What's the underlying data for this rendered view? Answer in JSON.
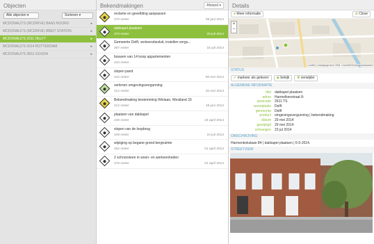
{
  "left": {
    "title": "Objecten",
    "filter_all": "Alle objecten",
    "filter_sort": "Sorteren",
    "objects": [
      {
        "label": "MCDONALD'S (MCDRIVE) BAAS NOORD",
        "selected": false
      },
      {
        "label": "MCDONALD'S (MCDRIVE) BBEIT STATION",
        "selected": false
      },
      {
        "label": "MCDONALD'S 2611 DELFT",
        "selected": true
      },
      {
        "label": "MCDONALD'S 3014 ROTTERDAM",
        "selected": false
      },
      {
        "label": "MCDONALD'S 3831 GOUDA",
        "selected": false
      }
    ]
  },
  "mid": {
    "title": "Bekendmakingen",
    "filter": "Afstand",
    "notices": [
      {
        "title": "reclame en gevelbling aanpassen",
        "distance": "270 meter",
        "date": "08 juni 2014",
        "icon": "yellow",
        "selected": false
      },
      {
        "title": "dakkapel plaatsen",
        "distance": "270 meter",
        "date": "29 juli 2014",
        "icon": "white",
        "selected": true
      },
      {
        "title": "Gemeente Delft, verkeersbesluit, instellen vergu...",
        "distance": "367 meter",
        "date": "16 juli 2014",
        "icon": "white",
        "selected": false
      },
      {
        "title": "bouwen van 14 koop appartementen",
        "distance": "410 meter",
        "date": "",
        "icon": "white",
        "selected": false
      },
      {
        "title": "slopen pand",
        "distance": "410 meter",
        "date": "08 mei 2014",
        "icon": "white",
        "selected": false
      },
      {
        "title": "verlenen omgevingsvergunning",
        "distance": "412 meter",
        "date": "15 mei 2014",
        "icon": "green",
        "selected": false
      },
      {
        "title": "Bekendmaking bestemming Wielaan, Westland 33",
        "distance": "412 meter",
        "date": "18 juni 2014",
        "icon": "yellow",
        "selected": false
      },
      {
        "title": "plaatsen van dakkapel",
        "distance": "449 meter",
        "date": "24 april 2014",
        "icon": "white",
        "selected": false
      },
      {
        "title": "slopen van de loopbrug",
        "distance": "449 meter",
        "date": "10 juli 2014",
        "icon": "white",
        "selected": false
      },
      {
        "title": "wijziging op begane grond bergruimte",
        "distance": "462 meter",
        "date": "01 april 2014",
        "icon": "white",
        "selected": false
      },
      {
        "title": "2 schoorsteen in woon- en werkeenheden",
        "distance": "476 meter",
        "date": "01 april 2014",
        "icon": "white",
        "selected": false
      }
    ]
  },
  "right": {
    "title": "Details",
    "more_info": "Meer informatie",
    "close": "Close",
    "map_attribution": "Leaflet | Kaartgegevens OSM, CartoDB/Ondergrondkaarten",
    "status_label": "STATUS",
    "status_buttons": [
      "markeer als gelezen",
      "bekijk",
      "verwijder"
    ],
    "general_label": "ALGEMENE INFORMATIE",
    "info": [
      {
        "key": "titel",
        "value": "dakkapel plaatsen"
      },
      {
        "key": "adres",
        "value": "Harmelkenstraat 8-"
      },
      {
        "key": "postcode",
        "value": "2611 TS"
      },
      {
        "key": "woonplaats",
        "value": "Delft"
      },
      {
        "key": "gemeente",
        "value": "Delft"
      },
      {
        "key": "product",
        "value": "omgevingsvergunning | bekendmaking"
      },
      {
        "key": "datum",
        "value": "29 mei 2014"
      },
      {
        "key": "gewijzigd",
        "value": "29 mei 2014"
      },
      {
        "key": "ontvangen",
        "value": "23 jul 2014"
      }
    ],
    "desc_label": "OMSCHRIJVING",
    "description": "Harmenkokslaan 84 | dakkapel plaatsen | 6-5-2014.",
    "preview_label": "STREETVIEW"
  }
}
